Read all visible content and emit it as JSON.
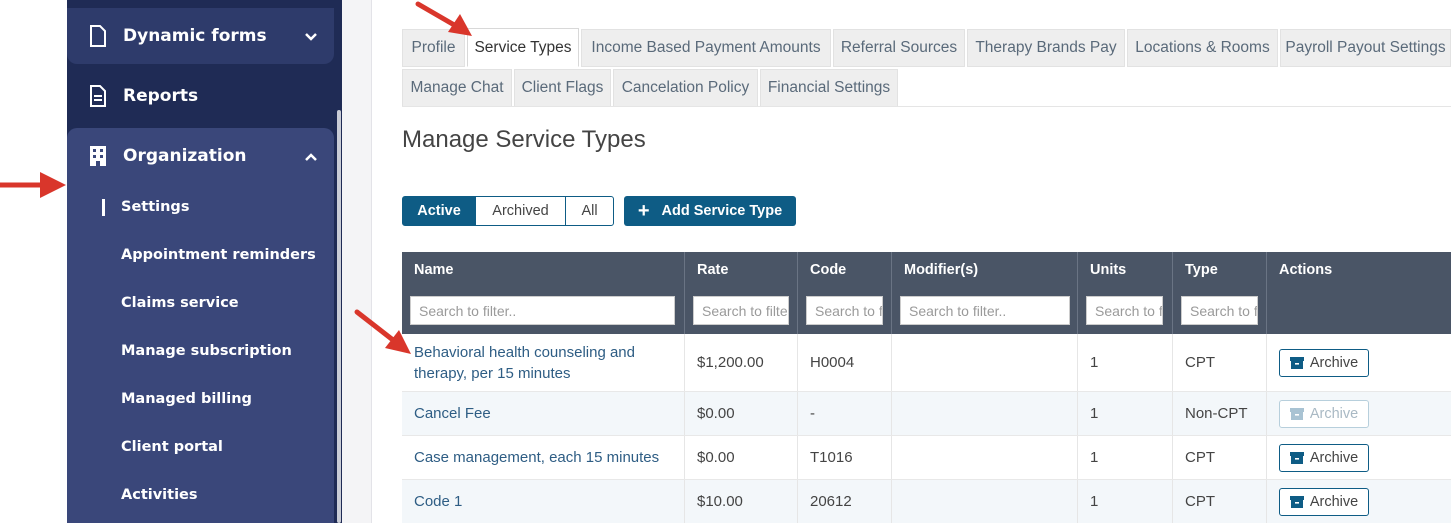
{
  "sidebar": {
    "dynamic_forms": "Dynamic forms",
    "reports": "Reports",
    "organization": "Organization",
    "sub_items": [
      "Settings",
      "Appointment reminders",
      "Claims service",
      "Manage subscription",
      "Managed billing",
      "Client portal",
      "Activities"
    ]
  },
  "tabs_row1": [
    "Profile",
    "Service Types",
    "Income Based Payment Amounts",
    "Referral Sources",
    "Therapy Brands Pay",
    "Locations & Rooms",
    "Payroll Payout Settings"
  ],
  "tabs_row2": [
    "Manage Chat",
    "Client Flags",
    "Cancelation Policy",
    "Financial Settings"
  ],
  "page_title": "Manage Service Types",
  "filters": [
    "Active",
    "Archived",
    "All"
  ],
  "add_button": "Add Service Type",
  "table": {
    "headers": [
      "Name",
      "Rate",
      "Code",
      "Modifier(s)",
      "Units",
      "Type",
      "Actions"
    ],
    "placeholders": [
      "Search to filter..",
      "Search to filter..",
      "Search to filter..",
      "Search to filter..",
      "Search to filter..",
      "Search to filter.."
    ],
    "rows": [
      {
        "name_line1": "Behavioral health counseling and",
        "name_line2": "therapy, per 15 minutes",
        "rate": "$1,200.00",
        "code": "H0004",
        "modifier": "",
        "units": "1",
        "type": "CPT",
        "action": "Archive"
      },
      {
        "name_line1": "Cancel Fee",
        "name_line2": "",
        "rate": "$0.00",
        "code": "-",
        "modifier": "",
        "units": "1",
        "type": "Non-CPT",
        "action": "Archive"
      },
      {
        "name_line1": "Case management, each 15 minutes",
        "name_line2": "",
        "rate": "$0.00",
        "code": "T1016",
        "modifier": "",
        "units": "1",
        "type": "CPT",
        "action": "Archive"
      },
      {
        "name_line1": "Code 1",
        "name_line2": "",
        "rate": "$10.00",
        "code": "20612",
        "modifier": "",
        "units": "1",
        "type": "CPT",
        "action": "Archive"
      }
    ]
  },
  "colors": {
    "primary": "#0e5c85",
    "sidebar": "#1f2b55",
    "annotation_arrow": "#d9362b"
  },
  "icons": [
    "document-icon",
    "report-icon",
    "building-icon",
    "chevron-down-icon",
    "chevron-up-icon",
    "plus-icon",
    "archive-box-icon",
    "annotation-arrow"
  ]
}
